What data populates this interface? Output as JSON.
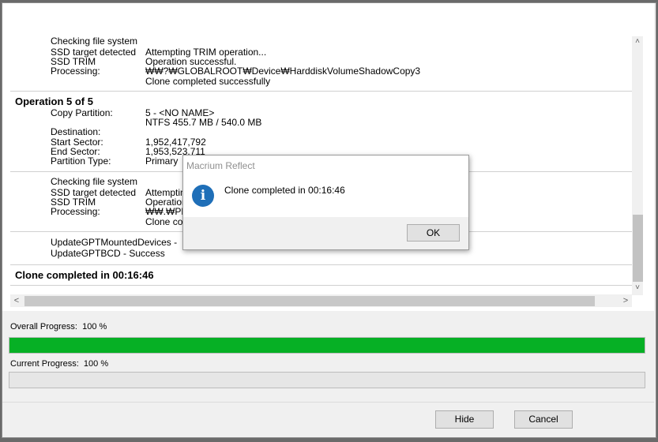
{
  "log": {
    "block1": {
      "lines": [
        {
          "key": "Checking file system",
          "value": ""
        },
        {
          "key": "SSD target detected",
          "value": "Attempting TRIM operation..."
        },
        {
          "key": "SSD TRIM",
          "value": "Operation successful."
        },
        {
          "key": "Processing:",
          "value": "₩₩?₩GLOBALROOT₩Device₩HarddiskVolumeShadowCopy3"
        },
        {
          "key": "",
          "value": "Clone completed successfully"
        }
      ]
    },
    "op5": {
      "header": "Operation 5 of 5",
      "copy_partition_key": "Copy Partition:",
      "copy_partition_value": "5 - <NO NAME>",
      "fs_value": "NTFS 455.7 MB / 540.0 MB",
      "destination_key": "Destination:",
      "start_sector_key": "Start Sector:",
      "start_sector_value": "1,952,417,792",
      "end_sector_key": "End Sector:",
      "end_sector_value": "1,953,523,711",
      "partition_type_key": "Partition Type:",
      "partition_type_value": "Primary"
    },
    "block3": {
      "lines": [
        {
          "key": "Checking file system",
          "value": ""
        },
        {
          "key": "SSD target detected",
          "value": "Attemptin"
        },
        {
          "key": "SSD TRIM",
          "value": "Operation"
        },
        {
          "key": "Processing:",
          "value": "₩₩.₩PH"
        },
        {
          "key": "",
          "value": "Clone co"
        }
      ]
    },
    "block4": {
      "line1": "UpdateGPTMountedDevices - ",
      "line2": "UpdateGPTBCD - Success"
    },
    "final": "Clone completed in 00:16:46"
  },
  "scroll": {
    "up": "˄",
    "down": "˅",
    "left": "<",
    "right": ">"
  },
  "overall": {
    "label": "Overall Progress:  100 %",
    "value": 100
  },
  "current": {
    "label": "Current Progress:  100 %",
    "value": 0
  },
  "buttons": {
    "hide": "Hide",
    "cancel": "Cancel"
  },
  "dialog": {
    "title": "Macrium Reflect",
    "icon": "i",
    "message": "Clone completed in 00:16:46",
    "ok": "OK"
  },
  "colors": {
    "progress_fill": "#06b025",
    "info_icon": "#1f6fb8"
  }
}
